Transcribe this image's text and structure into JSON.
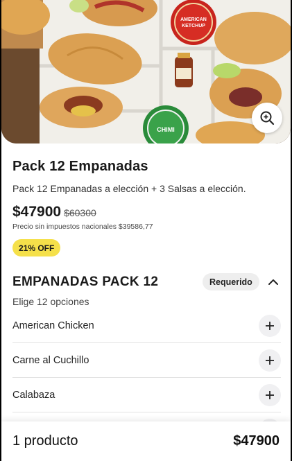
{
  "product": {
    "title": "Pack 12 Empanadas",
    "description": "Pack 12 Empanadas a elección + 3 Salsas a elección.",
    "price": "$47900",
    "old_price": "$60300",
    "tax_note": "Precio sin impuestos nacionales $39586,77",
    "discount_badge": "21% OFF"
  },
  "hero": {
    "sauce_label_1": "AMERICAN KETCHUP",
    "sauce_label_2": "CHIMI"
  },
  "section": {
    "title": "EMPANADAS PACK 12",
    "required_label": "Requerido",
    "subtitle": "Elige 12 opciones",
    "options": [
      {
        "label": "American Chicken"
      },
      {
        "label": "Carne al Cuchillo"
      },
      {
        "label": "Calabaza"
      },
      {
        "label": ""
      }
    ]
  },
  "footer": {
    "count_label": "1 producto",
    "total": "$47900"
  },
  "icons": {
    "zoom": "zoom-in-icon",
    "collapse": "chevron-up-icon",
    "add": "plus-icon"
  },
  "colors": {
    "discount_bg": "#f5e04a",
    "badge_bg": "#eeeeee"
  }
}
